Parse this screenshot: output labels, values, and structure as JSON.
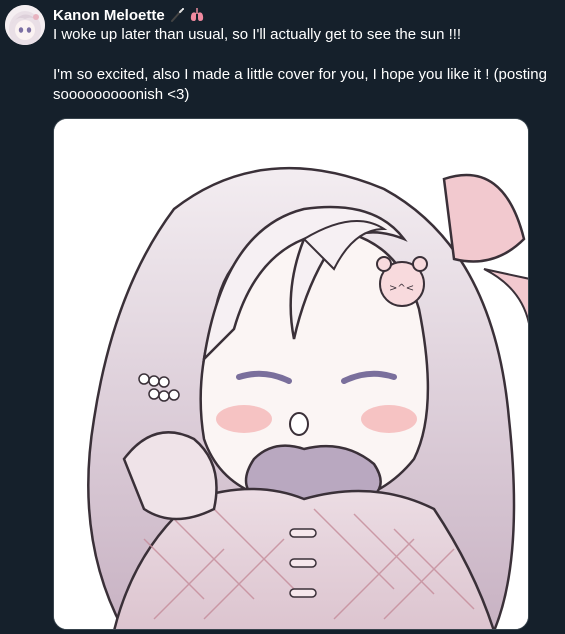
{
  "author": {
    "display_name": "Kanon Meloette",
    "avatar_icon": "avatar-image",
    "emojis": [
      "magic-wand-icon",
      "lungs-icon"
    ]
  },
  "tweet": {
    "line1": "I woke up later than usual, so I'll actually get to see the sun !!!",
    "line2": "I'm so excited, also I made a little cover for you, I hope you like it ! (posting sooooooooonish <3)"
  },
  "media": {
    "icon": "illustration-image",
    "description_icon": "chibi-girl-illustration"
  },
  "colors": {
    "background": "#15202b",
    "text": "#ffffff",
    "media_border": "#38444d"
  }
}
